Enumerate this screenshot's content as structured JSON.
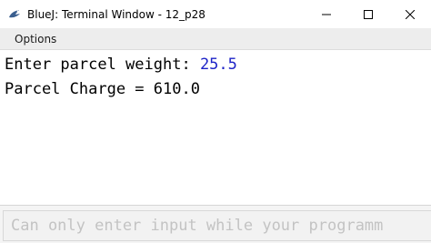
{
  "window": {
    "title": "BlueJ: Terminal Window - 12_p28",
    "icon": "bluej-bird-icon",
    "controls": {
      "minimize": "–",
      "maximize": "☐",
      "close": "✕"
    }
  },
  "menubar": {
    "items": [
      "Options"
    ]
  },
  "terminal": {
    "lines": [
      {
        "prompt": "Enter parcel weight: ",
        "input": "25.5"
      },
      {
        "text": "Parcel Charge = 610.0"
      }
    ]
  },
  "input_area": {
    "placeholder": "Can only enter input while your programm"
  },
  "colors": {
    "input_echo": "#1d23c7",
    "menubar_bg": "#ededed",
    "input_area_bg": "#f4f4f4"
  }
}
